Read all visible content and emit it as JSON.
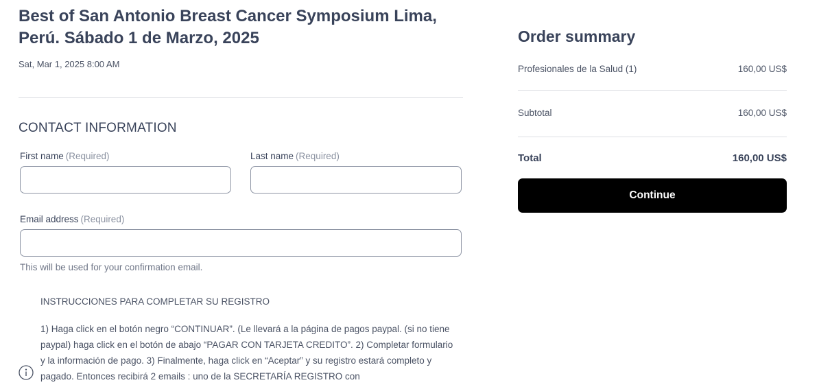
{
  "event": {
    "title": "Best of San Antonio Breast Cancer Symposium Lima, Perú. Sábado 1 de Marzo, 2025",
    "date": "Sat, Mar 1, 2025 8:00 AM"
  },
  "contact": {
    "heading": "CONTACT INFORMATION",
    "first_name": {
      "label": "First name",
      "required": "(Required)",
      "value": ""
    },
    "last_name": {
      "label": "Last name",
      "required": "(Required)",
      "value": ""
    },
    "email": {
      "label": "Email address",
      "required": "(Required)",
      "value": ""
    },
    "email_hint": "This will be used for your confirmation email."
  },
  "instructions": {
    "icon": "info-icon",
    "title": "INSTRUCCIONES PARA COMPLETAR SU REGISTRO",
    "body": "1) Haga click en el botón negro “CONTINUAR”. (Le llevará a la página de pagos paypal. (si no tiene paypal) haga click en el botón de abajo “PAGAR CON TARJETA CREDITO”. 2) Completar formulario y la información de pago. 3) Finalmente, haga click en “Aceptar” y su registro estará completo y pagado. Entonces recibirá 2 emails : uno de la SECRETARÍA REGISTRO con"
  },
  "summary": {
    "title": "Order summary",
    "line_item": {
      "label": "Profesionales de la Salud (1)",
      "amount": "160,00 US$"
    },
    "subtotal": {
      "label": "Subtotal",
      "amount": "160,00 US$"
    },
    "total": {
      "label": "Total",
      "amount": "160,00 US$"
    },
    "continue_label": "Continue"
  },
  "colors": {
    "text": "#39435a",
    "button_bg": "#000000",
    "button_text": "#ffffff",
    "divider": "#dcdee3"
  }
}
